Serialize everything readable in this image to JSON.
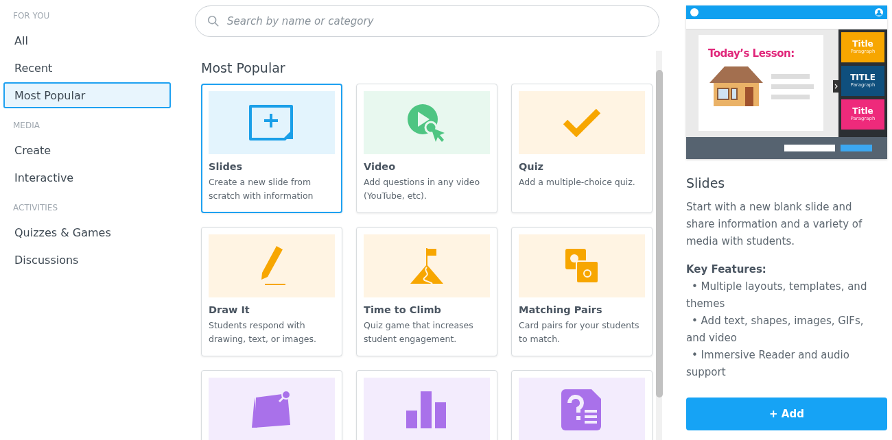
{
  "sidebar": {
    "sections": [
      {
        "heading": "FOR YOU",
        "items": [
          {
            "label": "All",
            "selected": false
          },
          {
            "label": "Recent",
            "selected": false
          },
          {
            "label": "Most Popular",
            "selected": true
          }
        ]
      },
      {
        "heading": "MEDIA",
        "items": [
          {
            "label": "Create",
            "selected": false
          },
          {
            "label": "Interactive",
            "selected": false
          }
        ]
      },
      {
        "heading": "ACTIVITIES",
        "items": [
          {
            "label": "Quizzes & Games",
            "selected": false
          },
          {
            "label": "Discussions",
            "selected": false
          }
        ]
      }
    ]
  },
  "search": {
    "placeholder": "Search by name or category"
  },
  "section_title": "Most Popular",
  "cards": [
    {
      "kind": "slides",
      "title": "Slides",
      "description": "Create a new slide from scratch with information",
      "selected": true
    },
    {
      "kind": "video",
      "title": "Video",
      "description": "Add questions in any video (YouTube, etc).",
      "selected": false
    },
    {
      "kind": "quiz",
      "title": "Quiz",
      "description": "Add a multiple-choice quiz.",
      "selected": false
    },
    {
      "kind": "draw",
      "title": "Draw It",
      "description": "Students respond with drawing, text, or images.",
      "selected": false
    },
    {
      "kind": "climb",
      "title": "Time to Climb",
      "description": "Quiz game that increases student engagement.",
      "selected": false
    },
    {
      "kind": "pairs",
      "title": "Matching Pairs",
      "description": "Card pairs for your students to match.",
      "selected": false
    },
    {
      "kind": "note",
      "selected": false
    },
    {
      "kind": "poll",
      "selected": false
    },
    {
      "kind": "question",
      "selected": false
    }
  ],
  "details": {
    "preview": {
      "heading": "Today’s Lesson:",
      "themes": [
        {
          "title": "Title",
          "paragraph": "Paragraph",
          "color": "#f7a600"
        },
        {
          "title": "TITLE",
          "paragraph": "Paragraph",
          "color": "#0f4f7d"
        },
        {
          "title": "Title",
          "paragraph": "Paragraph",
          "color": "#ee2a7b"
        }
      ]
    },
    "title": "Slides",
    "description": "Start with a new blank slide and share information and a variety of media with students.",
    "features_title": "Key Features:",
    "features": [
      "• Multiple layouts, templates, and themes",
      "• Add text, shapes, images, GIFs, and video",
      "• Immersive Reader and audio support"
    ],
    "add_button": "+ Add"
  }
}
